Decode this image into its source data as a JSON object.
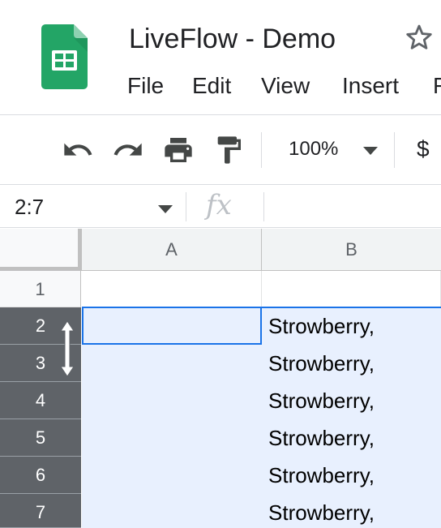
{
  "app": {
    "doc_title": "LiveFlow - Demo",
    "logo_icon": "google-sheets-logo",
    "brand_color": "#0f9d58"
  },
  "menu": {
    "items": [
      "File",
      "Edit",
      "View",
      "Insert",
      "F"
    ]
  },
  "toolbar": {
    "icons": [
      "undo-icon",
      "redo-icon",
      "print-icon",
      "paint-format-icon"
    ],
    "zoom": "100%",
    "currency": "$"
  },
  "formula_bar": {
    "name_box": "2:7",
    "fx_label": "fx"
  },
  "grid": {
    "columns": [
      "A",
      "B"
    ],
    "rows": [
      {
        "num": "1",
        "a": "",
        "b": "",
        "selected": false
      },
      {
        "num": "2",
        "a": "",
        "b": "Strowberry,",
        "selected": true
      },
      {
        "num": "3",
        "a": "",
        "b": "Strowberry,",
        "selected": true
      },
      {
        "num": "4",
        "a": "",
        "b": "Strowberry,",
        "selected": true
      },
      {
        "num": "5",
        "a": "",
        "b": "Strowberry,",
        "selected": true
      },
      {
        "num": "6",
        "a": "",
        "b": "Strowberry,",
        "selected": true
      },
      {
        "num": "7",
        "a": "",
        "b": "Strowberry,",
        "selected": true
      }
    ],
    "selection_color": "#e8f0fe",
    "accent_color": "#1a73e8"
  }
}
